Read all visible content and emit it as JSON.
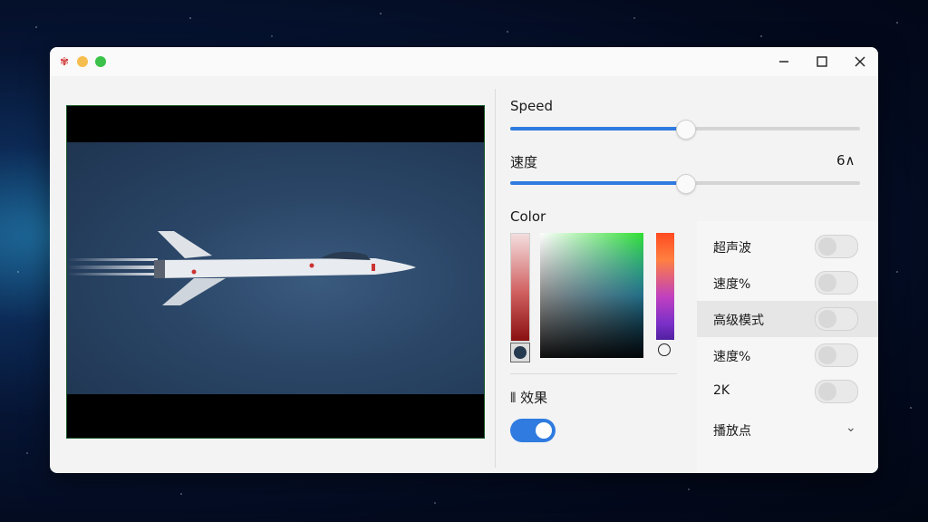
{
  "titlebar": {
    "app_icon": "app-logo-icon",
    "controls": [
      "minimize-icon",
      "maximize-icon",
      "close-icon"
    ]
  },
  "controls": {
    "speed": {
      "label": "Speed",
      "value": 0.5
    },
    "speed2": {
      "label": "速度",
      "readout": "6∧",
      "value": 0.5
    },
    "color": {
      "label": "Color"
    },
    "effect": {
      "label": "⫴ 效果",
      "enabled": true
    }
  },
  "options": [
    {
      "label": "超声波",
      "enabled": false
    },
    {
      "label": "速度%",
      "enabled": false
    },
    {
      "label": "高级模式",
      "enabled": false,
      "highlighted": true
    },
    {
      "label": "速度%",
      "enabled": false
    },
    {
      "label": "2K",
      "enabled": false
    }
  ],
  "dropdown": {
    "label": "播放点"
  },
  "colors": {
    "accent": "#2f7be0",
    "window": "#f3f3f3",
    "swatch": "#263a4f"
  }
}
